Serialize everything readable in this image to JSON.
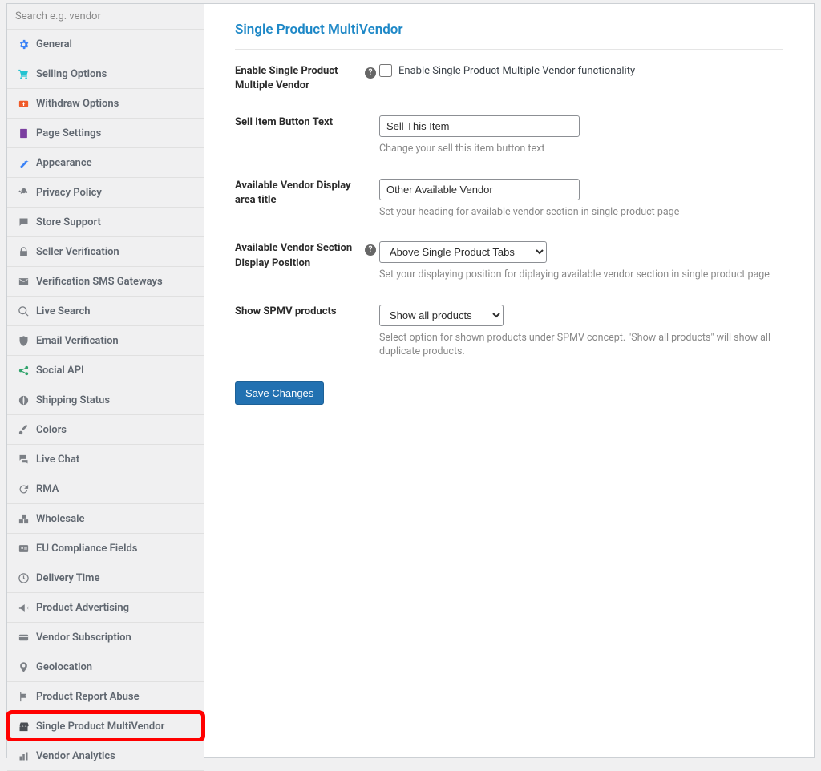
{
  "search": {
    "placeholder": "Search e.g. vendor"
  },
  "sidebar": {
    "items": [
      {
        "label": "General"
      },
      {
        "label": "Selling Options"
      },
      {
        "label": "Withdraw Options"
      },
      {
        "label": "Page Settings"
      },
      {
        "label": "Appearance"
      },
      {
        "label": "Privacy Policy"
      },
      {
        "label": "Store Support"
      },
      {
        "label": "Seller Verification"
      },
      {
        "label": "Verification SMS Gateways"
      },
      {
        "label": "Live Search"
      },
      {
        "label": "Email Verification"
      },
      {
        "label": "Social API"
      },
      {
        "label": "Shipping Status"
      },
      {
        "label": "Colors"
      },
      {
        "label": "Live Chat"
      },
      {
        "label": "RMA"
      },
      {
        "label": "Wholesale"
      },
      {
        "label": "EU Compliance Fields"
      },
      {
        "label": "Delivery Time"
      },
      {
        "label": "Product Advertising"
      },
      {
        "label": "Vendor Subscription"
      },
      {
        "label": "Geolocation"
      },
      {
        "label": "Product Report Abuse"
      },
      {
        "label": "Single Product MultiVendor"
      },
      {
        "label": "Vendor Analytics"
      }
    ]
  },
  "page": {
    "title": "Single Product MultiVendor"
  },
  "form": {
    "enable": {
      "label": "Enable Single Product Multiple Vendor",
      "checkbox_label": "Enable Single Product Multiple Vendor functionality"
    },
    "sell_btn": {
      "label": "Sell Item Button Text",
      "value": "Sell This Item",
      "desc": "Change your sell this item button text"
    },
    "area_title": {
      "label": "Available Vendor Display area title",
      "value": "Other Available Vendor",
      "desc": "Set your heading for available vendor section in single product page"
    },
    "position": {
      "label": "Available Vendor Section Display Position",
      "value": "Above Single Product Tabs",
      "desc": "Set your displaying position for diplaying available vendor section in single product page"
    },
    "show_spmv": {
      "label": "Show SPMV products",
      "value": "Show all products",
      "desc": "Select option for shown products under SPMV concept. \"Show all products\" will show all duplicate products."
    },
    "save": "Save Changes"
  },
  "icon_colors": {
    "general": "#3b82f6",
    "selling": "#22c3d1",
    "withdraw": "#f05a28",
    "page": "#7b3fa0",
    "appearance": "#3b82f6",
    "social": "#2fa36b",
    "default": "#7b7f85"
  }
}
